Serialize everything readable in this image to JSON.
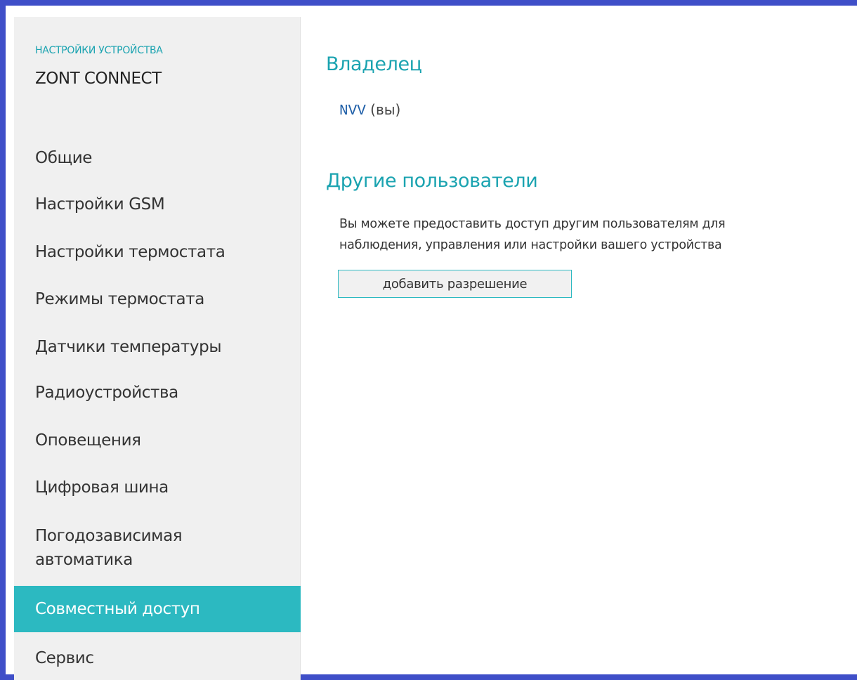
{
  "sidebar": {
    "subtitle": "НАСТРОЙКИ УСТРОЙСТВА",
    "title": "ZONT CONNECT",
    "items": [
      {
        "label": "Общие"
      },
      {
        "label": "Настройки GSM"
      },
      {
        "label": "Настройки термостата"
      },
      {
        "label": "Режимы термостата"
      },
      {
        "label": "Датчики температуры"
      },
      {
        "label": "Радиоустройства"
      },
      {
        "label": "Оповещения"
      },
      {
        "label": "Цифровая шина"
      },
      {
        "label": "Погодозависимая автоматика"
      },
      {
        "label": "Совместный доступ",
        "active": true
      },
      {
        "label": "Сервис"
      }
    ]
  },
  "main": {
    "owner_heading": "Владелец",
    "owner_name": "NVV",
    "owner_suffix": "(вы)",
    "others_heading": "Другие пользователи",
    "others_description_line1": "Вы можете предоставить доступ другим пользователям для",
    "others_description_line2": "наблюдения, управления или настройки вашего устройства",
    "add_permission_label": "добавить разрешение"
  },
  "colors": {
    "accent": "#2cb9c1",
    "heading": "#1aa3b0",
    "frame": "#3f4fc8",
    "sidebar_bg": "#f0f0f0"
  }
}
